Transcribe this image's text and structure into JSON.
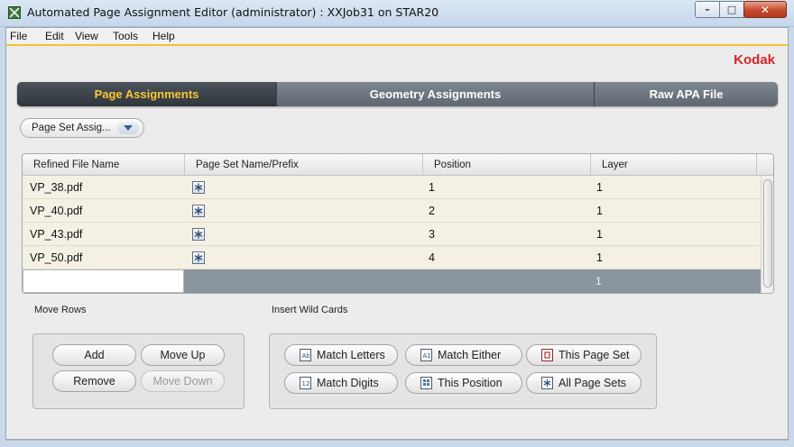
{
  "window": {
    "title": "Automated Page Assignment Editor (administrator) : XXJob31 on STAR20",
    "minimize_glyph": "–",
    "maximize_glyph": "□",
    "close_glyph": "✕"
  },
  "menu": [
    "File",
    "Edit",
    "View",
    "Tools",
    "Help"
  ],
  "brand": "Kodak",
  "colors": {
    "accent": "#f2c230",
    "brand_red": "#d2262a",
    "tab_active_text": "#f6c735",
    "selected_row": "#8b959f"
  },
  "tabs": [
    {
      "label": "Page Assignments",
      "active": true
    },
    {
      "label": "Geometry Assignments",
      "active": false
    },
    {
      "label": "Raw APA File",
      "active": false
    }
  ],
  "dropdown": {
    "selected": "Page Set Assig...",
    "icon": "chevron-down-icon"
  },
  "table": {
    "columns": [
      "Refined File Name",
      "Page Set Name/Prefix",
      "Position",
      "Layer"
    ],
    "rows": [
      {
        "file": "VP_38.pdf",
        "prefix_icon": "asterisk-wildcard-icon",
        "position": "1",
        "layer": "1"
      },
      {
        "file": "VP_40.pdf",
        "prefix_icon": "asterisk-wildcard-icon",
        "position": "2",
        "layer": "1"
      },
      {
        "file": "VP_43.pdf",
        "prefix_icon": "asterisk-wildcard-icon",
        "position": "3",
        "layer": "1"
      },
      {
        "file": "VP_50.pdf",
        "prefix_icon": "asterisk-wildcard-icon",
        "position": "4",
        "layer": "1"
      }
    ],
    "new_row": {
      "layer": "1"
    }
  },
  "move_rows": {
    "label": "Move Rows",
    "add": "Add",
    "move_up": "Move Up",
    "remove": "Remove",
    "move_down": "Move Down"
  },
  "wild_cards": {
    "label": "Insert Wild Cards",
    "buttons": [
      {
        "label": "Match Letters",
        "icon": "match-letters-icon"
      },
      {
        "label": "Match Either",
        "icon": "match-either-icon"
      },
      {
        "label": "This Page Set",
        "icon": "page-set-icon"
      },
      {
        "label": "Match Digits",
        "icon": "match-digits-icon"
      },
      {
        "label": "This Position",
        "icon": "position-icon"
      },
      {
        "label": "All Page Sets",
        "icon": "all-page-sets-icon"
      }
    ]
  }
}
